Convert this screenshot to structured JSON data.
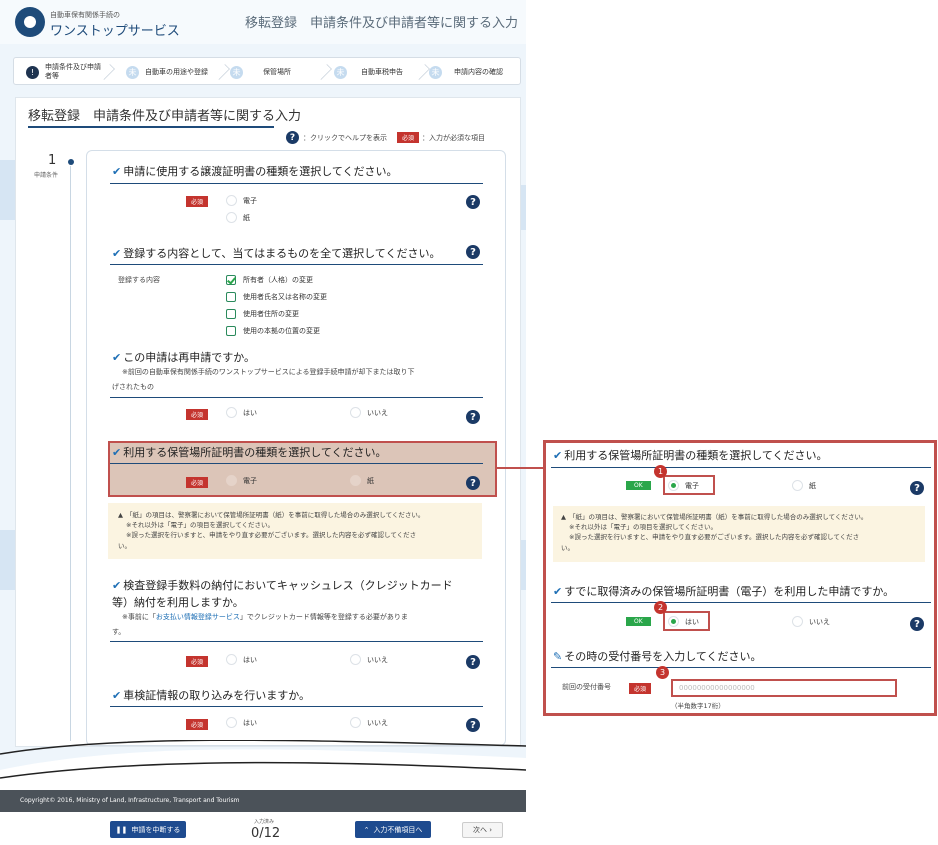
{
  "header": {
    "logo_sub": "自動車保有関係手続の",
    "logo_main": "ワンストップサービス",
    "title": "移転登録　申請条件及び申請者等に関する入力"
  },
  "steps": [
    {
      "label": "申請条件及び申請者等",
      "num": "!"
    },
    {
      "label": "自動車の用途や登録",
      "num": "未"
    },
    {
      "label": "保管場所",
      "num": "未"
    },
    {
      "label": "自動車税申告",
      "num": "未"
    },
    {
      "label": "申請内容の確認",
      "num": "未"
    }
  ],
  "page": {
    "title": "移転登録　申請条件及び申請者等に関する入力",
    "help_text": "：クリックでヘルプを表示",
    "required_label": "必須",
    "required_text": "：入力が必須な項目",
    "help_glyph": "?"
  },
  "sidebar": {
    "number": "1",
    "label": "申請条件"
  },
  "form": {
    "q1": {
      "check": "✔",
      "heading": "申請に使用する譲渡証明書の種類を選択してください。",
      "opt1": "電子",
      "opt2": "紙"
    },
    "q2": {
      "check": "✔",
      "heading": "登録する内容として、当てはまるものを全て選択してください。",
      "field_label": "登録する内容",
      "options": [
        "所有者（人格）の変更",
        "使用者氏名又は名称の変更",
        "使用者住所の変更",
        "使用の本拠の位置の変更"
      ]
    },
    "q3": {
      "check": "✔",
      "heading": "この申請は再申請ですか。",
      "note_line1": "※前回の自動車保有関係手続のワンストップサービスによる登録手続申請が却下または取り下",
      "note_line2": "げされたもの",
      "opt1": "はい",
      "opt2": "いいえ"
    },
    "q4": {
      "check": "✔",
      "heading": "利用する保管場所証明書の種類を選択してください。",
      "opt1": "電子",
      "opt2": "紙"
    },
    "warning": {
      "icon": "▲",
      "line1": "「紙」の項目は、警察署において保管場所証明書（紙）を事前に取得した場合のみ選択してください。",
      "line2": "※それ以外は「電子」の項目を選択してください。",
      "line3": "※誤った選択を行いますと、申請をやり直す必要がございます。選択した内容を必ず確認してくださ",
      "line4": "い。"
    },
    "q5": {
      "check": "✔",
      "heading_line1": "検査登録手数料の納付においてキャッシュレス（クレジットカード",
      "heading_line2": "等）納付を利用しますか。",
      "note_prefix": "※事前に「",
      "note_link": "お支払い情報登録サービス",
      "note_suffix": "」でクレジットカード情報等を登録する必要がありま",
      "note_line2": "す。",
      "opt1": "はい",
      "opt2": "いいえ"
    },
    "q6": {
      "check": "✔",
      "heading": "車検証情報の取り込みを行いますか。",
      "opt1": "はい",
      "opt2": "いいえ"
    }
  },
  "footer": {
    "copyright": "Copyright© 2016, Ministry of Land, Infrastructure, Transport and Tourism"
  },
  "bottom": {
    "suspend_button": "申請を中断する",
    "progress_label": "入力済み",
    "progress_value": "0/12",
    "jump_button": "入力不備項目へ",
    "next_button": "次へ ›"
  },
  "zoom": {
    "q1": {
      "check": "✔",
      "heading": "利用する保管場所証明書の種類を選択してください。",
      "ok": "OK",
      "opt1": "電子",
      "opt2": "紙"
    },
    "warning": {
      "icon": "▲",
      "line1": "「紙」の項目は、警察署において保管場所証明書（紙）を事前に取得した場合のみ選択してください。",
      "line2": "※それ以外は「電子」の項目を選択してください。",
      "line3": "※誤った選択を行いますと、申請をやり直す必要がございます。選択した内容を必ず確認してくださ",
      "line4": "い。"
    },
    "q2": {
      "check": "✔",
      "heading": "すでに取得済みの保管場所証明書（電子）を利用した申請ですか。",
      "ok": "OK",
      "opt1": "はい",
      "opt2": "いいえ"
    },
    "q3": {
      "icon": "✎",
      "heading": "その時の受付番号を入力してください。",
      "field_label": "前回の受付番号",
      "required": "必須",
      "placeholder": "00000000000000000",
      "hint": "（半角数字17桁）"
    },
    "badges": [
      "1",
      "2",
      "3"
    ]
  },
  "colors": {
    "accent": "#1e4b7a",
    "required": "#c4342e",
    "ok": "#2aa64a",
    "highlight": "#c0504d"
  }
}
